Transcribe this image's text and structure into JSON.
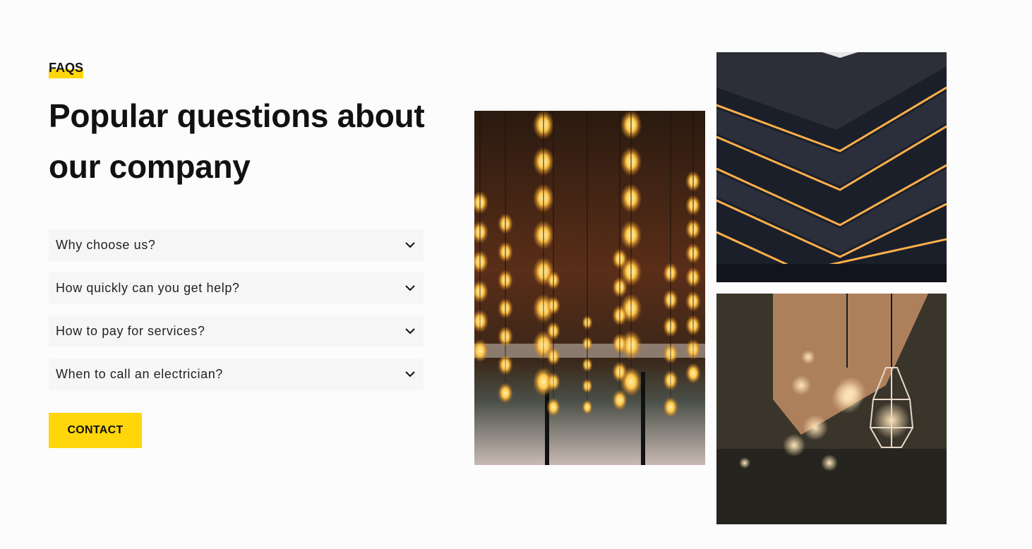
{
  "faq_section": {
    "eyebrow": "FAQS",
    "heading_line1": "Popular questions about",
    "heading_line2": "our company",
    "questions": [
      {
        "label": "Why choose us?",
        "icon": "chevron-down-icon"
      },
      {
        "label": "How quickly can you get help?",
        "icon": "chevron-down-icon"
      },
      {
        "label": "How to pay for services?",
        "icon": "chevron-down-icon"
      },
      {
        "label": "When to call an electrician?",
        "icon": "chevron-down-icon"
      }
    ],
    "contact_label": "CONTACT"
  },
  "gallery": {
    "images": [
      {
        "name": "hanging-edison-bulbs-photo"
      },
      {
        "name": "lit-atrium-floors-photo"
      },
      {
        "name": "caged-pendant-lamp-photo"
      }
    ]
  },
  "colors": {
    "accent": "#ffd60a",
    "text": "#111111",
    "item_bg": "#f6f6f6",
    "page_bg": "#fcfcfc"
  }
}
